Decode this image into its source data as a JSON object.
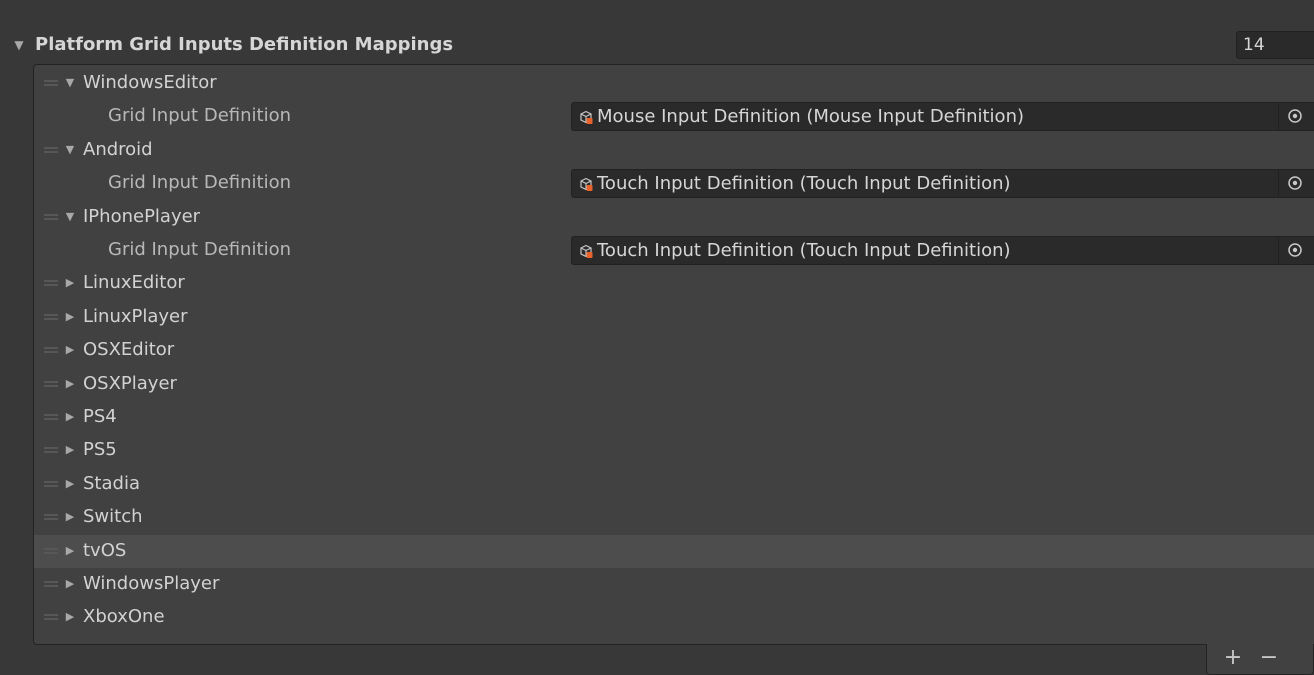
{
  "header": {
    "title": "Platform Grid Inputs Definition Mappings",
    "count": "14"
  },
  "items": [
    {
      "label": "WindowsEditor",
      "expanded": true,
      "field_label": "Grid Input Definition",
      "value": "Mouse Input Definition (Mouse Input Definition)"
    },
    {
      "label": "Android",
      "expanded": true,
      "field_label": "Grid Input Definition",
      "value": "Touch Input Definition (Touch Input Definition)"
    },
    {
      "label": "IPhonePlayer",
      "expanded": true,
      "field_label": "Grid Input Definition",
      "value": "Touch Input Definition (Touch Input Definition)"
    },
    {
      "label": "LinuxEditor",
      "expanded": false
    },
    {
      "label": "LinuxPlayer",
      "expanded": false
    },
    {
      "label": "OSXEditor",
      "expanded": false
    },
    {
      "label": "OSXPlayer",
      "expanded": false
    },
    {
      "label": "PS4",
      "expanded": false
    },
    {
      "label": "PS5",
      "expanded": false
    },
    {
      "label": "Stadia",
      "expanded": false
    },
    {
      "label": "Switch",
      "expanded": false
    },
    {
      "label": "tvOS",
      "expanded": false,
      "selected": true
    },
    {
      "label": "WindowsPlayer",
      "expanded": false
    },
    {
      "label": "XboxOne",
      "expanded": false
    }
  ],
  "footer": {
    "add_label": "+",
    "remove_label": "−"
  },
  "icons": {
    "expanded_arrow": "▼",
    "collapsed_arrow": "▶",
    "object_icon": "scriptable-object-icon",
    "picker_icon": "object-picker-icon"
  },
  "colors": {
    "background": "#383838",
    "list_background": "#414141",
    "field_background": "#2a2a2a",
    "selected_row": "#4d4d4d",
    "object_icon_accent": "#e8632b"
  }
}
